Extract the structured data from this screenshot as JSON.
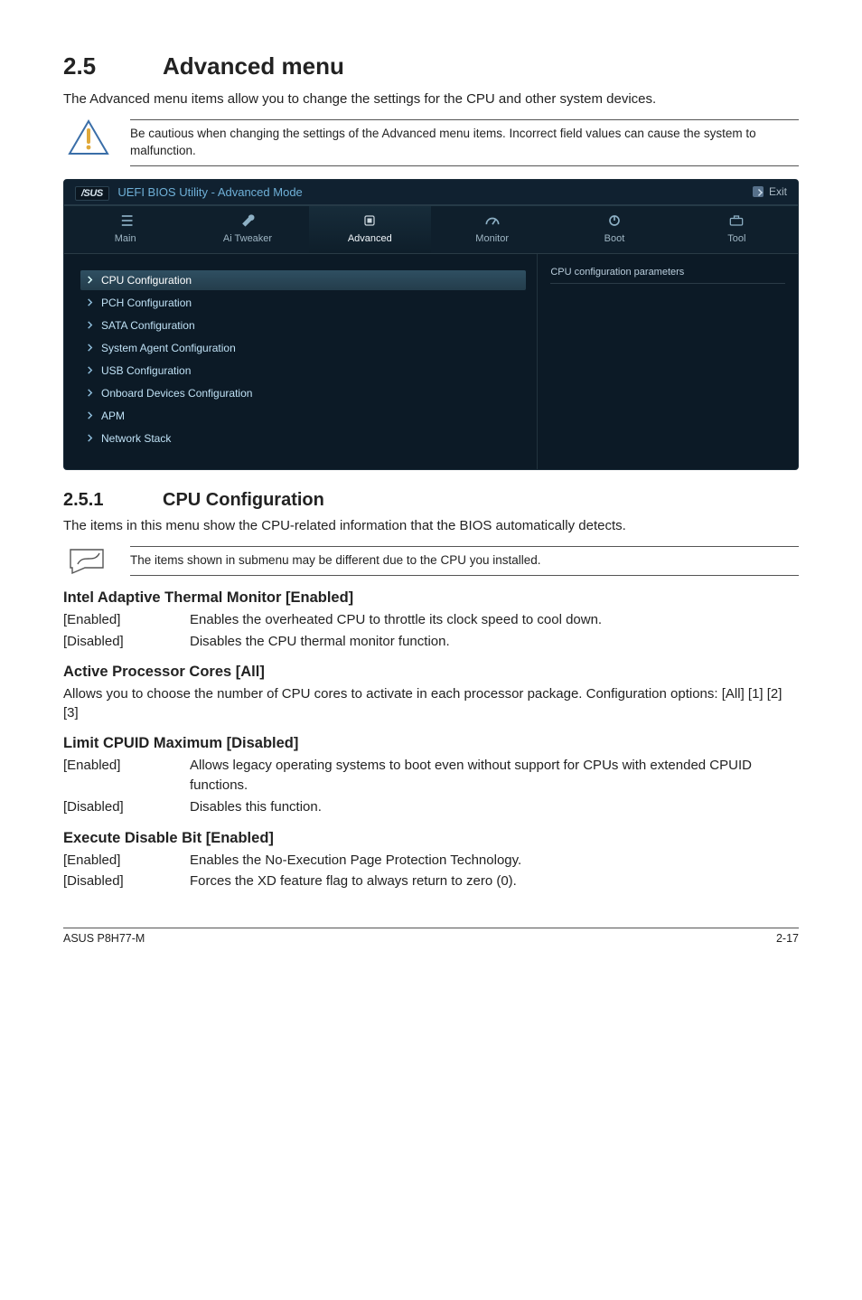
{
  "section": {
    "number": "2.5",
    "title": "Advanced menu"
  },
  "intro": "The Advanced menu items allow you to change the settings for the CPU and other system devices.",
  "warning": "Be cautious when changing the settings of the Advanced menu items. Incorrect field values can cause the system to malfunction.",
  "bios": {
    "brand": "/SUS",
    "title": "UEFI BIOS Utility - Advanced Mode",
    "exit_label": "Exit",
    "tabs": [
      {
        "label": "Main"
      },
      {
        "label": "Ai  Tweaker"
      },
      {
        "label": "Advanced"
      },
      {
        "label": "Monitor"
      },
      {
        "label": "Boot"
      },
      {
        "label": "Tool"
      }
    ],
    "right_heading": "CPU configuration parameters",
    "items": [
      "CPU Configuration",
      "PCH Configuration",
      "SATA Configuration",
      "System Agent Configuration",
      "USB Configuration",
      "Onboard Devices Configuration",
      "APM",
      "Network Stack"
    ]
  },
  "subsection": {
    "number": "2.5.1",
    "title": "CPU Configuration"
  },
  "sub_intro": "The items in this menu show the CPU-related information that the BIOS automatically detects.",
  "note": "The items shown in submenu may be different due to the CPU you installed.",
  "options": {
    "adaptive": {
      "heading": "Intel Adaptive Thermal Monitor [Enabled]",
      "rows": [
        {
          "k": "[Enabled]",
          "v": "Enables the overheated CPU to throttle its clock speed to cool down."
        },
        {
          "k": "[Disabled]",
          "v": "Disables the CPU thermal monitor function."
        }
      ]
    },
    "cores": {
      "heading": "Active Processor Cores [All]",
      "para": "Allows you to choose the number of CPU cores to activate in each processor package. Configuration options: [All] [1] [2] [3]"
    },
    "cpuid": {
      "heading": "Limit CPUID Maximum [Disabled]",
      "rows": [
        {
          "k": "[Enabled]",
          "v": "Allows legacy operating systems to boot even without support for CPUs with extended CPUID functions."
        },
        {
          "k": "[Disabled]",
          "v": "Disables this function."
        }
      ]
    },
    "xd": {
      "heading": "Execute Disable Bit [Enabled]",
      "rows": [
        {
          "k": "[Enabled]",
          "v": "Enables the No-Execution Page Protection Technology."
        },
        {
          "k": "[Disabled]",
          "v": "Forces the XD feature flag to always return to zero (0)."
        }
      ]
    }
  },
  "footer": {
    "left": "ASUS P8H77-M",
    "right": "2-17"
  }
}
